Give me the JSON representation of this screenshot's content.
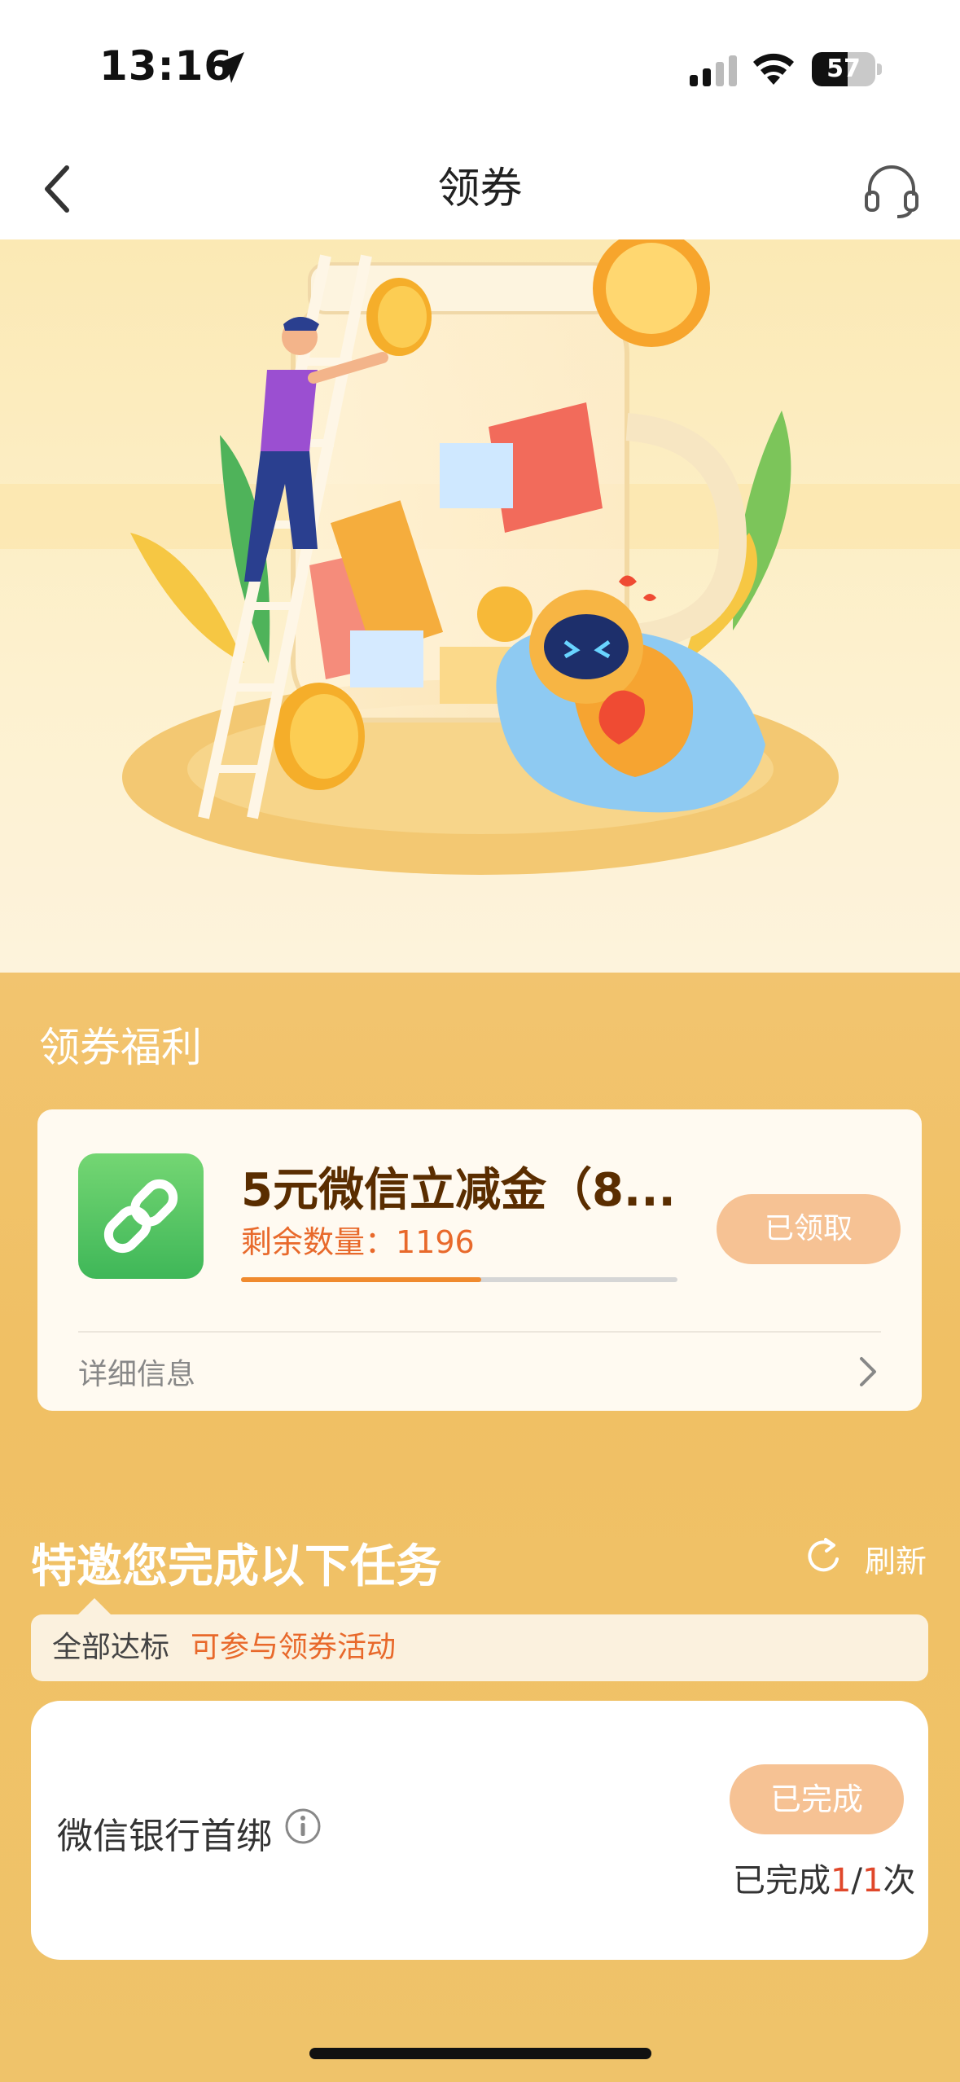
{
  "status_bar": {
    "time": "13:16",
    "battery": "57",
    "battery_level": 0.57
  },
  "nav": {
    "title": "领券"
  },
  "coupon_section": {
    "title": "领券福利",
    "coupon": {
      "name": "5元微信立减金（8...",
      "remain_label": "剩余数量：",
      "remain_count": "1196",
      "progress": 0.55,
      "button_label": "已领取",
      "detail_label": "详细信息"
    }
  },
  "task_section": {
    "title": "特邀您完成以下任务",
    "refresh_label": "刷新",
    "notice_text": "全部达标",
    "notice_highlight": "可参与领券活动",
    "task": {
      "name": "微信银行首绑",
      "button_label": "已完成",
      "count_prefix": "已完成",
      "count_done": "1",
      "count_sep": "/",
      "count_total": "1",
      "count_suffix": "次"
    }
  },
  "colors": {
    "accent": "#e8692b",
    "section_bg": "#f0c064",
    "button_bg": "#f6c294"
  }
}
